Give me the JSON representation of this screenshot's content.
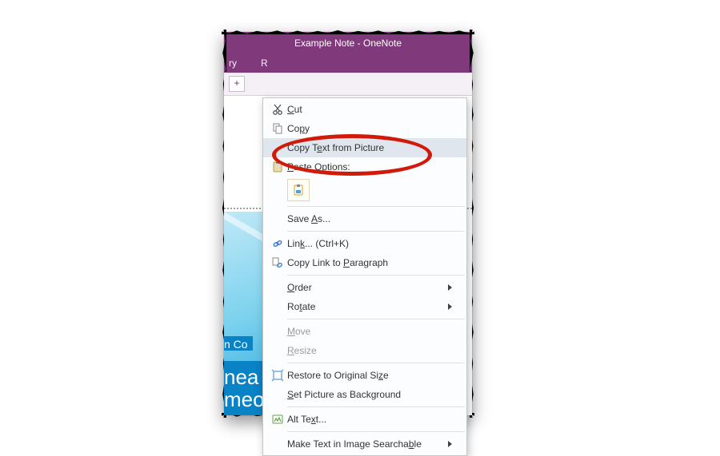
{
  "window": {
    "title": "Example Note  -  OneNote"
  },
  "ribbon": {
    "tab1": "ry",
    "tab2": "R"
  },
  "tabstrip": {
    "add": "+"
  },
  "menu": {
    "cut": "Cut",
    "copy": "Copy",
    "copy_ocr": "Copy Text from Picture",
    "paste_opts": "Paste Options:",
    "save_as": "Save As...",
    "link": "Link...  (Ctrl+K)",
    "copy_link": "Copy Link to Paragraph",
    "order": "Order",
    "rotate": "Rotate",
    "move": "Move",
    "resize": "Resize",
    "restore": "Restore to Original Size",
    "set_bg": "Set Picture as Background",
    "alt_text": "Alt Text...",
    "searchable": "Make Text in Image Searchable"
  },
  "note_image": {
    "line1": "n Co",
    "line2": "nea",
    "line3": "meone else"
  }
}
